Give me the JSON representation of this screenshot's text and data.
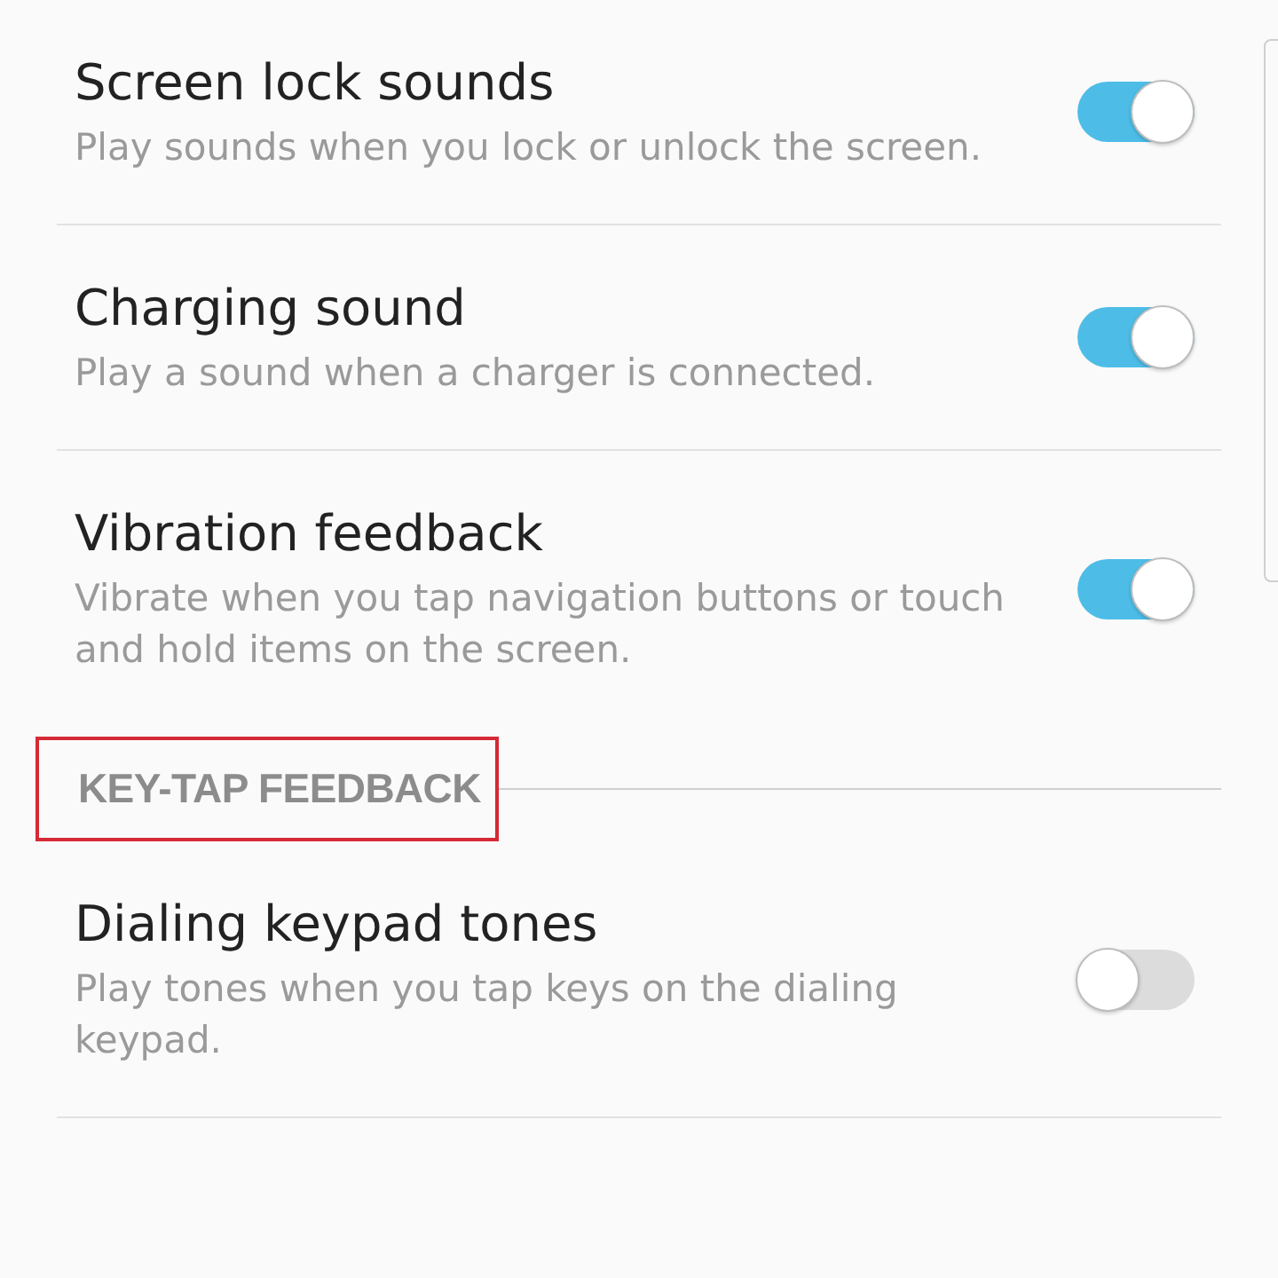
{
  "items": [
    {
      "kind": "toggle",
      "title": "Screen lock sounds",
      "description": "Play sounds when you lock or unlock the screen.",
      "on": true
    },
    {
      "kind": "toggle",
      "title": "Charging sound",
      "description": "Play a sound when a charger is connected.",
      "on": true
    },
    {
      "kind": "toggle",
      "title": "Vibration feedback",
      "description": "Vibrate when you tap navigation buttons or touch and hold items on the screen.",
      "on": true
    },
    {
      "kind": "header",
      "title": "KEY-TAP FEEDBACK",
      "highlighted": true
    },
    {
      "kind": "toggle",
      "title": "Dialing keypad tones",
      "description": "Play tones when you tap keys on the dialing keypad.",
      "on": false
    }
  ]
}
